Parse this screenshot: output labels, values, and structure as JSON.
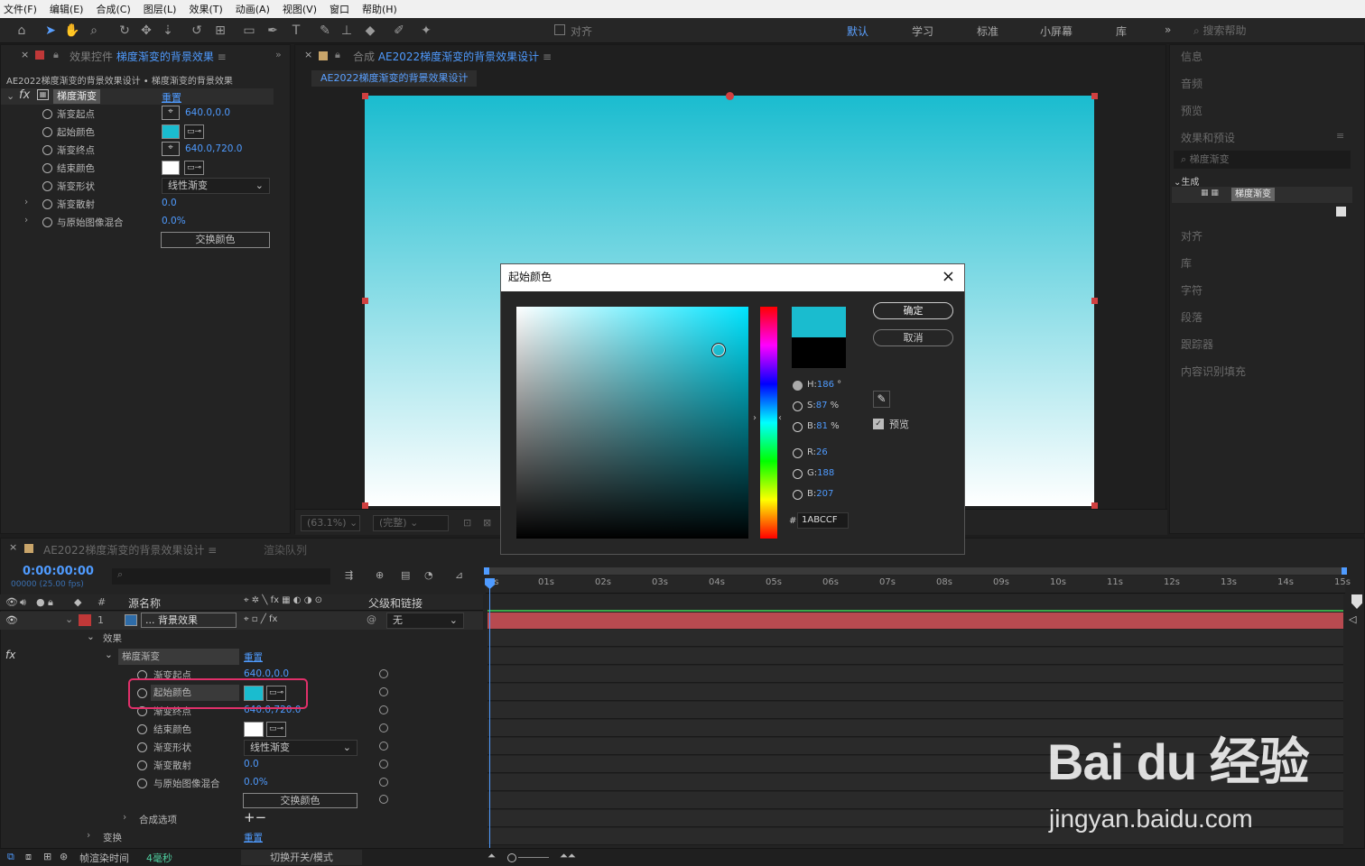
{
  "menu": [
    "文件(F)",
    "编辑(E)",
    "合成(C)",
    "图层(L)",
    "效果(T)",
    "动画(A)",
    "视图(V)",
    "窗口",
    "帮助(H)"
  ],
  "toolbar": {
    "align_label": "对齐",
    "search_placeholder": "搜索帮助"
  },
  "workspaces": [
    "默认",
    "学习",
    "标准",
    "小屏幕",
    "库"
  ],
  "effect_controls": {
    "tab_prefix": "效果控件",
    "tab_name": "梯度渐变的背景效果",
    "breadcrumb": "AE2022梯度渐变的背景效果设计 • 梯度渐变的背景效果",
    "effect_name": "梯度渐变",
    "reset": "重置",
    "props": [
      {
        "label": "渐变起点",
        "value": "640.0,0.0"
      },
      {
        "label": "起始颜色",
        "value": ""
      },
      {
        "label": "渐变终点",
        "value": "640.0,720.0"
      },
      {
        "label": "结束颜色",
        "value": ""
      },
      {
        "label": "渐变形状",
        "value": "线性渐变"
      },
      {
        "label": "渐变散射",
        "value": "0.0"
      },
      {
        "label": "与原始图像混合",
        "value": "0.0%"
      }
    ],
    "swap_button": "交换颜色"
  },
  "composition": {
    "tab_prefix": "合成",
    "tab_name": "AE2022梯度渐变的背景效果设计",
    "sub_tab": "AE2022梯度渐变的背景效果设计",
    "zoom": "(63.1%)",
    "quality": "(完整)"
  },
  "right_panel": {
    "items_top": [
      "信息",
      "音频",
      "预览",
      "效果和预设"
    ],
    "search_text": "梯度渐变",
    "group": "生成",
    "group_item": "梯度渐变",
    "items_bottom": [
      "对齐",
      "库",
      "字符",
      "段落",
      "跟踪器",
      "内容识别填充"
    ]
  },
  "color_dialog": {
    "title": "起始颜色",
    "ok": "确定",
    "cancel": "取消",
    "preview_label": "预览",
    "h_label": "H:",
    "h": "186",
    "h_unit": "°",
    "s_label": "S:",
    "s": "87",
    "s_unit": "%",
    "b_label": "B:",
    "b": "81",
    "b_unit": "%",
    "r_label": "R:",
    "r": "26",
    "g_label": "G:",
    "g": "188",
    "bb_label": "B:",
    "bb": "207",
    "hex_label": "#",
    "hex": "1ABCCF",
    "new_color": "#1abccf",
    "old_color": "#000000"
  },
  "timeline": {
    "tab_name": "AE2022梯度渐变的背景效果设计",
    "render_queue": "渲染队列",
    "timecode": "0:00:00:00",
    "frame_info": "00000 (25.00 fps)",
    "col_hash": "#",
    "col_source": "源名称",
    "col_parent": "父级和链接",
    "layer_num": "1",
    "layer_name": "... 背景效果",
    "parent_value": "无",
    "effects_label": "效果",
    "effect_name": "梯度渐变",
    "reset": "重置",
    "props": [
      {
        "label": "渐变起点",
        "value": "640.0,0.0"
      },
      {
        "label": "起始颜色",
        "value": ""
      },
      {
        "label": "渐变终点",
        "value": "640.0,720.0"
      },
      {
        "label": "结束颜色",
        "value": ""
      },
      {
        "label": "渐变形状",
        "value": "线性渐变"
      },
      {
        "label": "渐变散射",
        "value": "0.0"
      },
      {
        "label": "与原始图像混合",
        "value": "0.0%"
      }
    ],
    "swap_button": "交换颜色",
    "comp_options": "合成选项",
    "transform": "变换",
    "transform_reset": "重置",
    "ticks": [
      "0s",
      "01s",
      "02s",
      "03s",
      "04s",
      "05s",
      "06s",
      "07s",
      "08s",
      "09s",
      "10s",
      "11s",
      "12s",
      "13s",
      "14s",
      "15s"
    ],
    "footer_render": "帧渲染时间",
    "footer_ms": "4毫秒",
    "footer_toggle": "切换开关/模式"
  },
  "watermark": {
    "brand": "Bai du 经验",
    "url": "jingyan.baidu.com"
  },
  "colors": {
    "accent": "#4f9bff",
    "start_color": "#1abccf",
    "end_color": "#ffffff",
    "layer_bar": "#b84a50",
    "highlight": "#e0306a"
  }
}
